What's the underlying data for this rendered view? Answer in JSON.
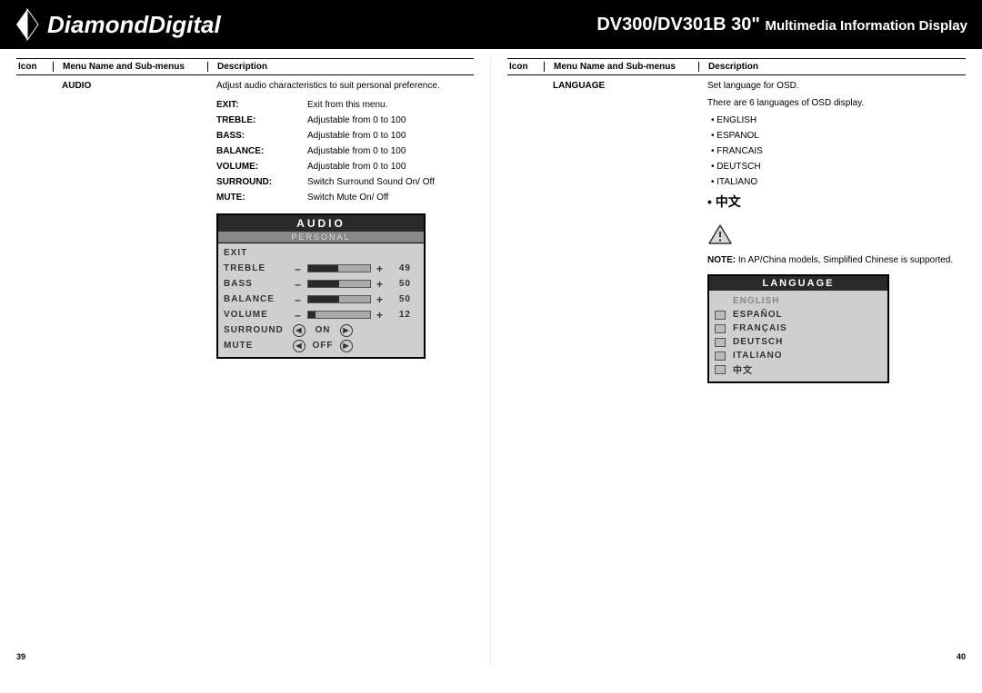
{
  "header": {
    "brand": "DiamondDigital",
    "model_prefix": "DV300/DV301B 30\"",
    "model_suffix": "Multimedia Information Display"
  },
  "columns": {
    "icon": "Icon",
    "menu": "Menu Name and Sub-menus",
    "desc": "Description"
  },
  "left": {
    "menu_name": "AUDIO",
    "description": "Adjust audio characteristics to suit personal preference.",
    "items": [
      {
        "label": "EXIT:",
        "desc": "Exit from this menu."
      },
      {
        "label": "TREBLE:",
        "desc": "Adjustable from 0 to 100"
      },
      {
        "label": "BASS:",
        "desc": "Adjustable from 0 to 100"
      },
      {
        "label": "BALANCE:",
        "desc": "Adjustable from 0 to 100"
      },
      {
        "label": "VOLUME:",
        "desc": "Adjustable from 0 to 100"
      },
      {
        "label": "SURROUND:",
        "desc": "Switch Surround Sound On/ Off"
      },
      {
        "label": "MUTE:",
        "desc": "Switch Mute On/ Off"
      }
    ],
    "osd": {
      "title": "AUDIO",
      "subtitle": "PERSONAL",
      "rows": [
        {
          "label": "EXIT",
          "type": "plain"
        },
        {
          "label": "TREBLE",
          "type": "slider",
          "value": "49",
          "fill": 49
        },
        {
          "label": "BASS",
          "type": "slider",
          "value": "50",
          "fill": 50
        },
        {
          "label": "BALANCE",
          "type": "slider",
          "value": "50",
          "fill": 50
        },
        {
          "label": "VOLUME",
          "type": "slider",
          "value": "12",
          "fill": 12
        },
        {
          "label": "SURROUND",
          "type": "toggle",
          "state": "ON"
        },
        {
          "label": "MUTE",
          "type": "toggle",
          "state": "OFF"
        }
      ]
    },
    "page_number": "39"
  },
  "right": {
    "menu_name": "LANGUAGE",
    "desc_line1": "Set language for OSD.",
    "desc_line2": "There are 6 languages of OSD display.",
    "languages": [
      "ENGLISH",
      "ESPANOL",
      "FRANCAIS",
      "DEUTSCH",
      "ITALIANO"
    ],
    "cjk_label": "中文",
    "note_label": "NOTE:",
    "note_text": "In AP/China models, Simplified Chinese is supported.",
    "osd": {
      "title": "LANGUAGE",
      "rows": [
        {
          "label": "ENGLISH",
          "selected": true
        },
        {
          "label": "ESPAÑOL",
          "selected": false
        },
        {
          "label": "FRANÇAIS",
          "selected": false
        },
        {
          "label": "DEUTSCH",
          "selected": false
        },
        {
          "label": "ITALIANO",
          "selected": false
        },
        {
          "label": "中文",
          "selected": false
        }
      ]
    },
    "page_number": "40"
  }
}
